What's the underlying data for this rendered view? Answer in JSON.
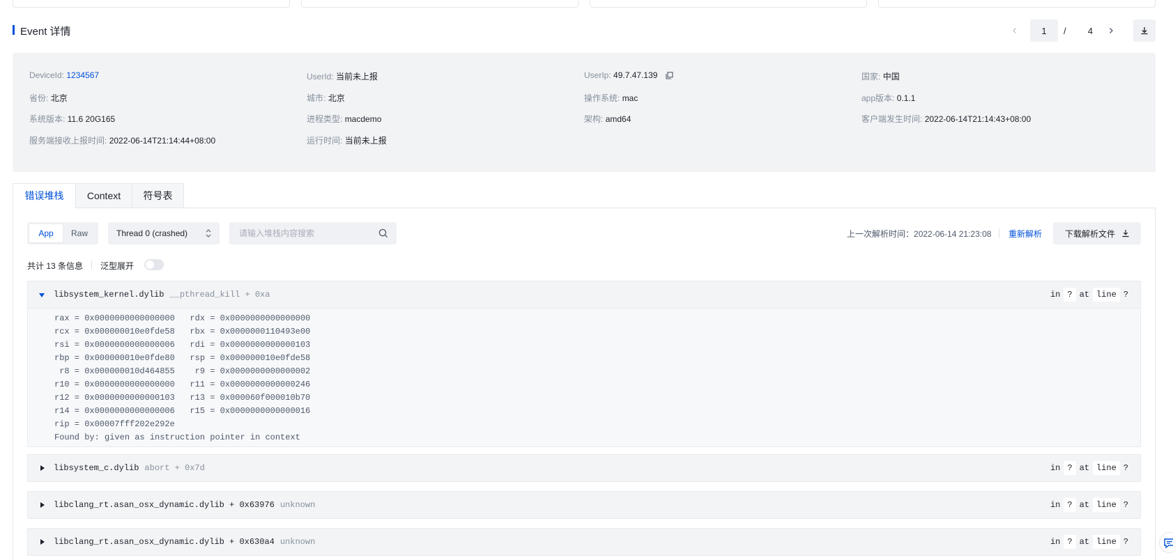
{
  "header": {
    "title": "Event 详情",
    "pager": {
      "current": "1",
      "separator": "/",
      "total": "4"
    }
  },
  "info": {
    "device_id": {
      "label": "DeviceId:",
      "value": "1234567"
    },
    "user_id": {
      "label": "UserId:",
      "value": "当前未上报"
    },
    "user_ip": {
      "label": "UserIp:",
      "value": "49.7.47.139"
    },
    "country": {
      "label": "国家:",
      "value": "中国"
    },
    "province": {
      "label": "省份:",
      "value": "北京"
    },
    "city": {
      "label": "城市:",
      "value": "北京"
    },
    "os": {
      "label": "操作系统:",
      "value": "mac"
    },
    "app_version": {
      "label": "app版本:",
      "value": "0.1.1"
    },
    "sys_version": {
      "label": "系统版本:",
      "value": "11.6 20G165"
    },
    "process_type": {
      "label": "进程类型:",
      "value": "macdemo"
    },
    "arch": {
      "label": "架构:",
      "value": "amd64"
    },
    "client_time": {
      "label": "客户端发生时间:",
      "value": "2022-06-14T21:14:43+08:00"
    },
    "server_time": {
      "label": "服务端接收上报时间:",
      "value": "2022-06-14T21:14:44+08:00"
    },
    "run_time": {
      "label": "运行时间:",
      "value": "当前未上报"
    }
  },
  "tabs": [
    "错误堆栈",
    "Context",
    "符号表"
  ],
  "toolbar": {
    "mode_app": "App",
    "mode_raw": "Raw",
    "thread": "Thread 0 (crashed)",
    "search_placeholder": "请输入堆栈内容搜索",
    "last_parse_label": "上一次解析时间：",
    "last_parse_time": "2022-06-14 21:23:08",
    "reparse": "重新解析",
    "download": "下载解析文件"
  },
  "summary": {
    "count_text": "共计 13 条信息",
    "generic_expand": "泛型展开"
  },
  "frames": [
    {
      "lib": "libsystem_kernel.dylib",
      "fn": "__pthread_kill + 0xa",
      "in": "in",
      "q1": "?",
      "at": "at",
      "line": "line",
      "q2": "?",
      "body": "rax = 0x0000000000000000   rdx = 0x0000000000000000\nrcx = 0x000000010e0fde58   rbx = 0x0000000110493e00\nrsi = 0x0000000000000006   rdi = 0x0000000000000103\nrbp = 0x000000010e0fde80   rsp = 0x000000010e0fde58\n r8 = 0x000000010d464855    r9 = 0x0000000000000002\nr10 = 0x0000000000000000   r11 = 0x0000000000000246\nr12 = 0x0000000000000103   r13 = 0x000060f000010b70\nr14 = 0x0000000000000006   r15 = 0x0000000000000016\nrip = 0x00007fff202e292e\nFound by: given as instruction pointer in context"
    },
    {
      "lib": "libsystem_c.dylib",
      "fn": "abort + 0x7d",
      "in": "in",
      "q1": "?",
      "at": "at",
      "line": "line",
      "q2": "?"
    },
    {
      "lib": "libclang_rt.asan_osx_dynamic.dylib + 0x63976",
      "fn": "unknown",
      "in": "in",
      "q1": "?",
      "at": "at",
      "line": "line",
      "q2": "?"
    },
    {
      "lib": "libclang_rt.asan_osx_dynamic.dylib + 0x630a4",
      "fn": "unknown",
      "in": "in",
      "q1": "?",
      "at": "at",
      "line": "line",
      "q2": "?"
    }
  ],
  "colors": {
    "accent": "#0052d9",
    "panel_bg": "#f2f3f5"
  }
}
